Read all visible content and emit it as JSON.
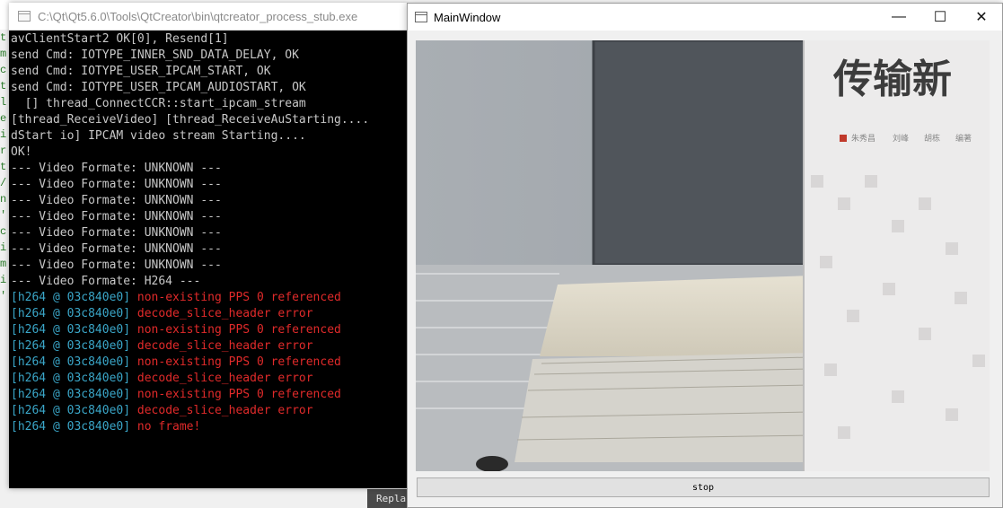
{
  "console_window": {
    "title": "C:\\Qt\\Qt5.6.0\\Tools\\QtCreator\\bin\\qtcreator_process_stub.exe",
    "lines": [
      {
        "prefix": "",
        "text": "avClientStart2 OK[0], Resend[1]",
        "style": "normal"
      },
      {
        "prefix": "",
        "text": "send Cmd: IOTYPE_INNER_SND_DATA_DELAY, OK",
        "style": "normal"
      },
      {
        "prefix": "",
        "text": "send Cmd: IOTYPE_USER_IPCAM_START, OK",
        "style": "normal"
      },
      {
        "prefix": "",
        "text": "send Cmd: IOTYPE_USER_IPCAM_AUDIOSTART, OK",
        "style": "normal"
      },
      {
        "prefix": "",
        "text": "  [] thread_ConnectCCR::start_ipcam_stream",
        "style": "normal"
      },
      {
        "prefix": "",
        "text": "[thread_ReceiveVideo] [thread_ReceiveAuStarting....",
        "style": "normal"
      },
      {
        "prefix": "",
        "text": "dStart io] IPCAM video stream Starting....",
        "style": "normal"
      },
      {
        "prefix": "",
        "text": "OK!",
        "style": "normal"
      },
      {
        "prefix": "",
        "text": "--- Video Formate: UNKNOWN ---",
        "style": "normal"
      },
      {
        "prefix": "",
        "text": "--- Video Formate: UNKNOWN ---",
        "style": "normal"
      },
      {
        "prefix": "",
        "text": "--- Video Formate: UNKNOWN ---",
        "style": "normal"
      },
      {
        "prefix": "",
        "text": "--- Video Formate: UNKNOWN ---",
        "style": "normal"
      },
      {
        "prefix": "",
        "text": "--- Video Formate: UNKNOWN ---",
        "style": "normal"
      },
      {
        "prefix": "",
        "text": "--- Video Formate: UNKNOWN ---",
        "style": "normal"
      },
      {
        "prefix": "",
        "text": "--- Video Formate: UNKNOWN ---",
        "style": "normal"
      },
      {
        "prefix": "",
        "text": "--- Video Formate: H264 ---",
        "style": "normal"
      },
      {
        "prefix": "[h264 @ 03c840e0] ",
        "text": "non-existing PPS 0 referenced",
        "style": "error"
      },
      {
        "prefix": "[h264 @ 03c840e0] ",
        "text": "decode_slice_header error",
        "style": "error"
      },
      {
        "prefix": "[h264 @ 03c840e0] ",
        "text": "non-existing PPS 0 referenced",
        "style": "error"
      },
      {
        "prefix": "[h264 @ 03c840e0] ",
        "text": "decode_slice_header error",
        "style": "error"
      },
      {
        "prefix": "[h264 @ 03c840e0] ",
        "text": "non-existing PPS 0 referenced",
        "style": "error"
      },
      {
        "prefix": "[h264 @ 03c840e0] ",
        "text": "decode_slice_header error",
        "style": "error"
      },
      {
        "prefix": "[h264 @ 03c840e0] ",
        "text": "non-existing PPS 0 referenced",
        "style": "error"
      },
      {
        "prefix": "[h264 @ 03c840e0] ",
        "text": "decode_slice_header error",
        "style": "error"
      },
      {
        "prefix": "[h264 @ 03c840e0] ",
        "text": "no frame!",
        "style": "error"
      }
    ]
  },
  "background_editor": {
    "gutter_chars": [
      "t",
      "m",
      "c",
      "t",
      "l",
      "e",
      "i",
      "r",
      "t",
      "/",
      "n",
      "'",
      "",
      "",
      "c",
      "i",
      "m",
      "i",
      "'"
    ],
    "replace_tab_label": "Repla"
  },
  "main_window": {
    "title": "MainWindow",
    "minimize_glyph": "—",
    "maximize_glyph": "☐",
    "close_glyph": "✕",
    "video": {
      "book_title": "传输新",
      "book_authors": [
        "朱秀昌",
        "刘峰",
        "胡栋",
        "编著"
      ]
    },
    "stop_button_label": "stop"
  },
  "colors": {
    "console_bg": "#000000",
    "console_text": "#c8c8c8",
    "log_prefix": "#3aa6c8",
    "log_error": "#e02a2a",
    "window_bg": "#f0f0f0"
  }
}
